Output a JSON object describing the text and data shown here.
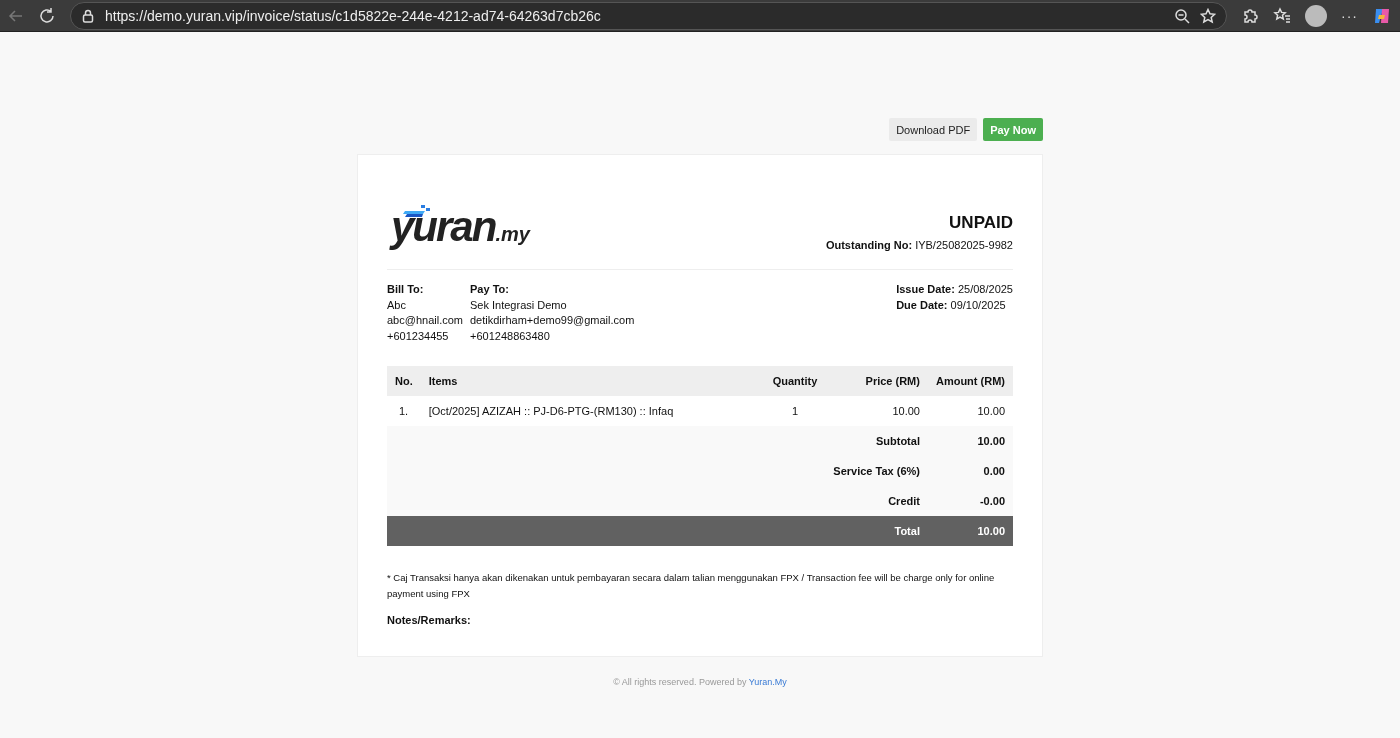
{
  "browser": {
    "url": "https://demo.yuran.vip/invoice/status/c1d5822e-244e-4212-ad74-64263d7cb26c",
    "more": "···"
  },
  "actions": [
    {
      "label": "Download PDF",
      "kind": "secondary"
    },
    {
      "label": "Pay Now",
      "kind": "primary"
    }
  ],
  "invoice": {
    "logo": {
      "name": "yuran",
      "suffix": ".my"
    },
    "status": "UNPAID",
    "outstanding_label": "Outstanding No:",
    "outstanding_no": "IYB/25082025-9982",
    "bill_to": {
      "label": "Bill To:",
      "lines": [
        "Abc",
        "abc@hnail.com",
        "+601234455"
      ]
    },
    "pay_to": {
      "label": "Pay To:",
      "lines": [
        "Sek Integrasi Demo",
        "detikdirham+demo99@gmail.com",
        "+601248863480"
      ]
    },
    "dates": [
      {
        "label": "Issue Date:",
        "value": "25/08/2025"
      },
      {
        "label": "Due Date:",
        "value": "09/10/2025"
      }
    ],
    "table": {
      "columns": [
        "No.",
        "Items",
        "Quantity",
        "Price (RM)",
        "Amount (RM)"
      ],
      "rows": [
        [
          "1.",
          "[Oct/2025] AZIZAH :: PJ-D6-PTG-(RM130) :: Infaq",
          "1",
          "10.00",
          "10.00"
        ]
      ],
      "summary": [
        {
          "label": "Subtotal",
          "value": "10.00",
          "kind": "line"
        },
        {
          "label": "Service Tax (6%)",
          "value": "0.00",
          "kind": "line"
        },
        {
          "label": "Credit",
          "value": "-0.00",
          "kind": "line"
        },
        {
          "label": "Total",
          "value": "10.00",
          "kind": "total"
        }
      ]
    },
    "note": "* Caj Transaksi hanya akan dikenakan untuk pembayaran secara dalam talian menggunakan FPX / Transaction fee will be charge only for online payment using FPX",
    "remarks_label": "Notes/Remarks:"
  },
  "footer": {
    "text": "© All rights reserved. Powered by",
    "link": "Yuran.My"
  }
}
